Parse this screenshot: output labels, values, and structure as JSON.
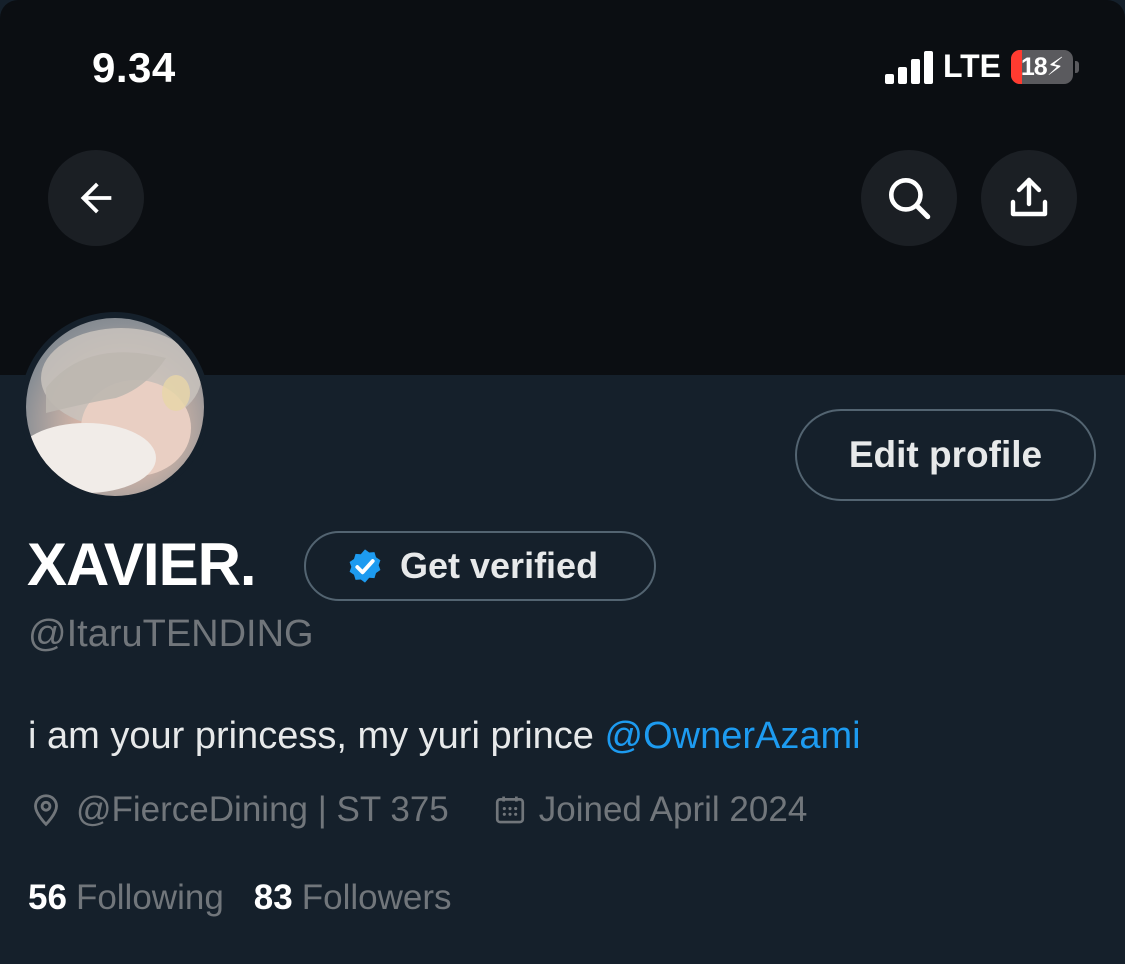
{
  "status_bar": {
    "time": "9.34",
    "network": "LTE",
    "battery_level": "18",
    "battery_fraction": 0.18,
    "signal_bars": 4
  },
  "header": {
    "back_icon": "arrow-left-icon",
    "search_icon": "search-icon",
    "share_icon": "share-upload-icon"
  },
  "profile": {
    "avatar_icon": "avatar-photo",
    "edit_button_label": "Edit profile",
    "display_name": "XAVIER.",
    "verify_badge_icon": "verified-badge-icon",
    "get_verified_label": "Get verified",
    "handle": "@ItaruTENDING",
    "bio_text": "i am your princess, my yuri prince ",
    "bio_mention": "@OwnerAzami",
    "location_icon": "location-pin-icon",
    "location": "@FierceDining | ST 375",
    "joined_icon": "calendar-icon",
    "joined": "Joined April 2024",
    "following_count": "56",
    "following_label": "Following",
    "followers_count": "83",
    "followers_label": "Followers"
  },
  "colors": {
    "background": "#15202b",
    "banner": "#0b0e12",
    "accent": "#1d9bf0",
    "secondary_text": "#71767b",
    "battery_low": "#ff3b30"
  }
}
